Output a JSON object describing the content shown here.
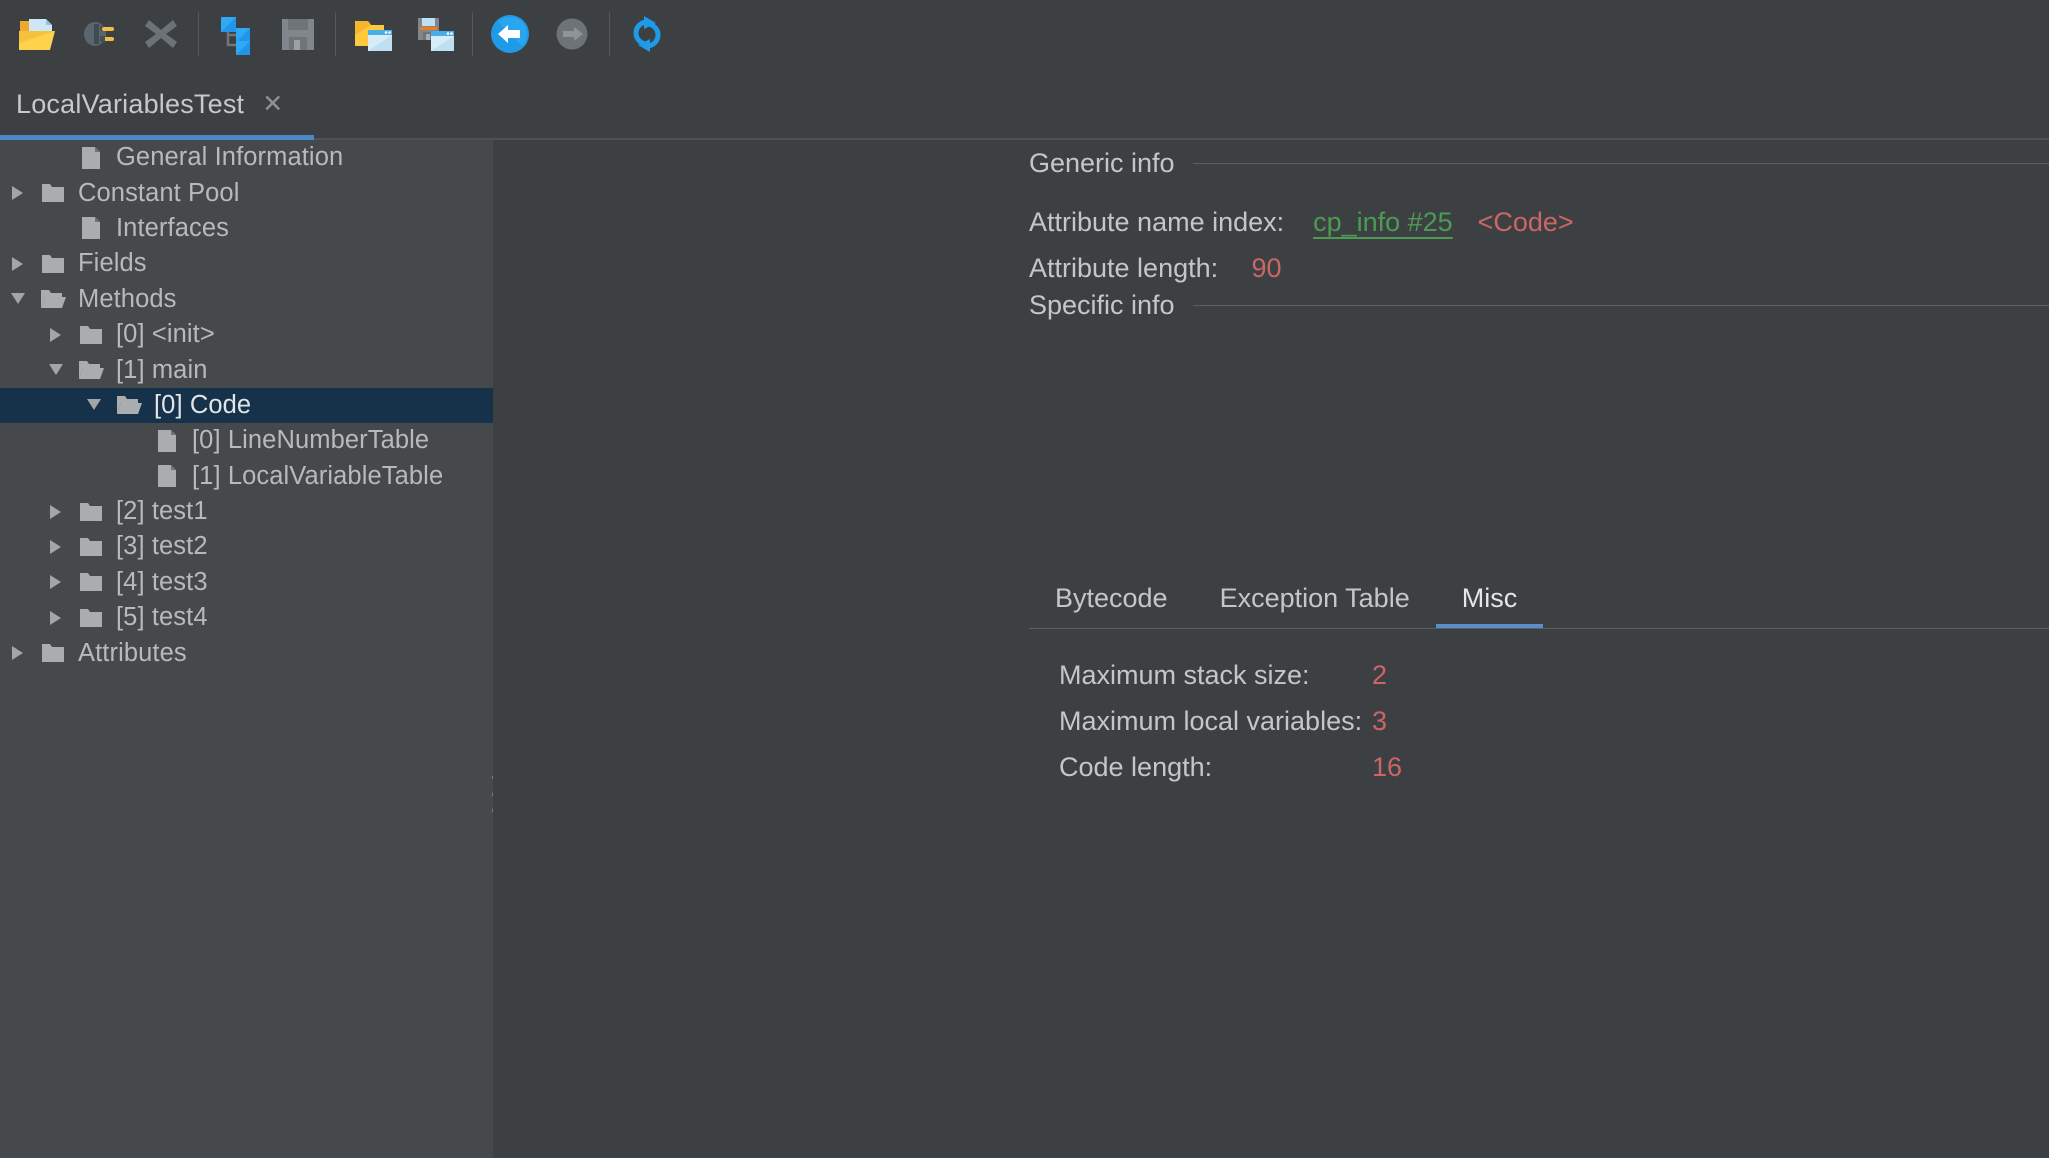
{
  "toolbar": {
    "groups": [
      [
        {
          "name": "open-class-file-icon",
          "label": "Open class file"
        },
        {
          "name": "open-runtime-class-icon",
          "label": "Open class from runtime library"
        },
        {
          "name": "close-icon",
          "label": "Close"
        }
      ],
      [
        {
          "name": "browse-class-path-icon",
          "label": "Browse class path"
        },
        {
          "name": "save-icon",
          "label": "Save"
        }
      ],
      [
        {
          "name": "reopen-window-icon",
          "label": "Reopen window"
        },
        {
          "name": "save-window-icon",
          "label": "Save window"
        }
      ],
      [
        {
          "name": "back-icon",
          "label": "Backward"
        },
        {
          "name": "forward-icon",
          "label": "Forward"
        }
      ],
      [
        {
          "name": "reload-icon",
          "label": "Reload"
        }
      ]
    ]
  },
  "document_tab": {
    "title": "LocalVariablesTest",
    "close_glyph": "✕"
  },
  "tree": {
    "items": [
      {
        "indent": 1,
        "arrow": "none",
        "icon": "file-icon",
        "label": "General Information",
        "selected": false
      },
      {
        "indent": 0,
        "arrow": "collapsed",
        "icon": "folder-icon",
        "label": "Constant Pool",
        "selected": false
      },
      {
        "indent": 1,
        "arrow": "none",
        "icon": "file-icon",
        "label": "Interfaces",
        "selected": false
      },
      {
        "indent": 0,
        "arrow": "collapsed",
        "icon": "folder-icon",
        "label": "Fields",
        "selected": false
      },
      {
        "indent": 0,
        "arrow": "expanded",
        "icon": "folder-open-icon",
        "label": "Methods",
        "selected": false
      },
      {
        "indent": 1,
        "arrow": "collapsed",
        "icon": "folder-icon",
        "label": "[0] <init>",
        "selected": false
      },
      {
        "indent": 1,
        "arrow": "expanded",
        "icon": "folder-open-icon",
        "label": "[1] main",
        "selected": false
      },
      {
        "indent": 2,
        "arrow": "expanded",
        "icon": "folder-open-icon",
        "label": "[0] Code",
        "selected": true
      },
      {
        "indent": 3,
        "arrow": "none",
        "icon": "file-icon",
        "label": "[0] LineNumberTable",
        "selected": false
      },
      {
        "indent": 3,
        "arrow": "none",
        "icon": "file-icon",
        "label": "[1] LocalVariableTable",
        "selected": false
      },
      {
        "indent": 1,
        "arrow": "collapsed",
        "icon": "folder-icon",
        "label": "[2] test1",
        "selected": false
      },
      {
        "indent": 1,
        "arrow": "collapsed",
        "icon": "folder-icon",
        "label": "[3] test2",
        "selected": false
      },
      {
        "indent": 1,
        "arrow": "collapsed",
        "icon": "folder-icon",
        "label": "[4] test3",
        "selected": false
      },
      {
        "indent": 1,
        "arrow": "collapsed",
        "icon": "folder-icon",
        "label": "[5] test4",
        "selected": false
      },
      {
        "indent": 0,
        "arrow": "collapsed",
        "icon": "folder-icon",
        "label": "Attributes",
        "selected": false
      }
    ]
  },
  "detail": {
    "generic_info": {
      "heading": "Generic info",
      "attribute_name_index_label": "Attribute name index:",
      "attribute_name_index_link": "cp_info #25",
      "attribute_name_index_extra": "<Code>",
      "attribute_length_label": "Attribute length:",
      "attribute_length_value": "90"
    },
    "specific_info": {
      "heading": "Specific info",
      "tabs": [
        {
          "label": "Bytecode",
          "active": false
        },
        {
          "label": "Exception Table",
          "active": false
        },
        {
          "label": "Misc",
          "active": true
        }
      ],
      "misc": [
        {
          "label": "Maximum stack size:",
          "value": "2"
        },
        {
          "label": "Maximum local variables:",
          "value": "3"
        },
        {
          "label": "Code length:",
          "value": "16"
        }
      ]
    }
  },
  "colors": {
    "background": "#3c4043",
    "tree_background": "#45494c",
    "selection": "#16324a",
    "accent_blue": "#4a88c7",
    "link_green": "#4d9b53",
    "value_red": "#cc6666",
    "text": "#c3c7ca"
  }
}
